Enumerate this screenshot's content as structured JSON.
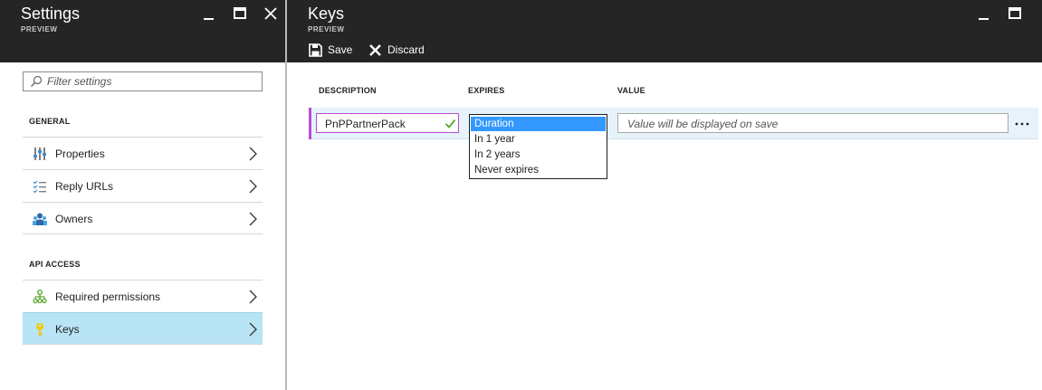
{
  "settings_blade": {
    "title": "Settings",
    "subtitle": "PREVIEW",
    "search_placeholder": "Filter settings",
    "general_label": "GENERAL",
    "api_label": "API ACCESS",
    "general_items": [
      {
        "label": "Properties",
        "icon": "properties-icon"
      },
      {
        "label": "Reply URLs",
        "icon": "reply-urls-icon"
      },
      {
        "label": "Owners",
        "icon": "owners-icon"
      }
    ],
    "api_items": [
      {
        "label": "Required permissions",
        "icon": "permissions-icon"
      },
      {
        "label": "Keys",
        "icon": "key-icon",
        "selected": true
      }
    ]
  },
  "keys_blade": {
    "title": "Keys",
    "subtitle": "PREVIEW",
    "toolbar": {
      "save_label": "Save",
      "discard_label": "Discard"
    },
    "columns": {
      "description": "DESCRIPTION",
      "expires": "EXPIRES",
      "value": "VALUE"
    },
    "row": {
      "description": "PnPPartnerPack",
      "value_placeholder": "Value will be displayed on save"
    },
    "expires_dropdown": {
      "options": [
        "Duration",
        "In 1 year",
        "In 2 years",
        "Never expires"
      ],
      "selected": "Duration"
    }
  },
  "colors": {
    "header_bg": "#252526",
    "selected_item_bg": "#b8e4f5",
    "accent_purple": "#b84bd6",
    "dropdown_selection": "#3399ff",
    "row_bg": "#e7f3fb"
  }
}
